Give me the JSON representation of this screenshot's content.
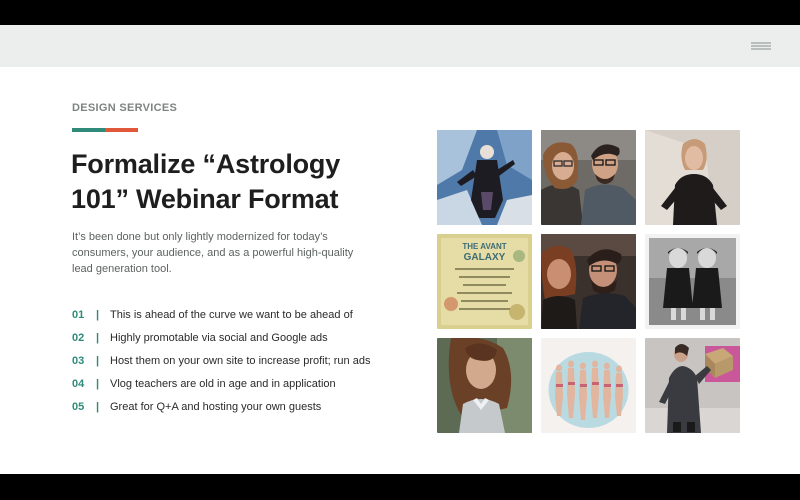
{
  "slide": {
    "eyebrow": "DESIGN SERVICES",
    "title": "Formalize “Astrology 101” Webinar Format",
    "subtitle": "It’s been done but only lightly modernized for today’s consumers, your audience, and as a powerful high-quality lead generation tool.",
    "accent_colors": [
      "#2f8a7a",
      "#e0573a"
    ],
    "list": [
      {
        "num": "01",
        "sep": "|",
        "text": "This is ahead of the curve we want to be ahead of"
      },
      {
        "num": "02",
        "sep": "|",
        "text": "Highly promotable via social and Google ads"
      },
      {
        "num": "03",
        "sep": "|",
        "text": "Host them on your own site to increase profit; run ads"
      },
      {
        "num": "04",
        "sep": "|",
        "text": "Vlog teachers are old in age and in application"
      },
      {
        "num": "05",
        "sep": "|",
        "text": "Great for Q+A and hosting your own guests"
      }
    ]
  },
  "menu": {
    "icon": "hamburger-menu-icon"
  },
  "gallery": {
    "photos": [
      {
        "name": "photo-illustrated-figure",
        "icon": "art-illustration"
      },
      {
        "name": "photo-couple-selfie",
        "icon": "portrait-pair"
      },
      {
        "name": "photo-woman-black-sweater",
        "icon": "portrait-single"
      },
      {
        "name": "photo-the-avant-galaxy",
        "icon": "text-poster",
        "text": "THE AVANT GALAXY"
      },
      {
        "name": "photo-couple-selfie-dark",
        "icon": "portrait-pair"
      },
      {
        "name": "photo-twin-girls",
        "icon": "portrait-pair-bw"
      },
      {
        "name": "photo-woman-hair-portrait",
        "icon": "portrait-single"
      },
      {
        "name": "photo-watercolor-figures",
        "icon": "art-illustration"
      },
      {
        "name": "photo-woman-with-box",
        "icon": "portrait-single"
      }
    ]
  }
}
